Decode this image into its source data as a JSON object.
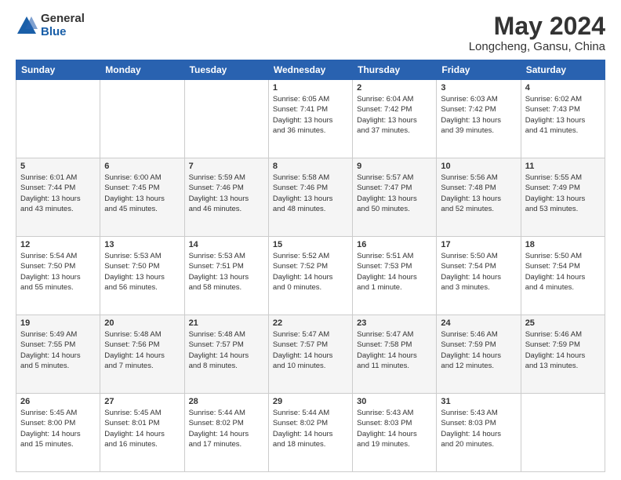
{
  "logo": {
    "general": "General",
    "blue": "Blue"
  },
  "title": "May 2024",
  "subtitle": "Longcheng, Gansu, China",
  "days_of_week": [
    "Sunday",
    "Monday",
    "Tuesday",
    "Wednesday",
    "Thursday",
    "Friday",
    "Saturday"
  ],
  "weeks": [
    [
      {
        "day": "",
        "info": ""
      },
      {
        "day": "",
        "info": ""
      },
      {
        "day": "",
        "info": ""
      },
      {
        "day": "1",
        "info": "Sunrise: 6:05 AM\nSunset: 7:41 PM\nDaylight: 13 hours\nand 36 minutes."
      },
      {
        "day": "2",
        "info": "Sunrise: 6:04 AM\nSunset: 7:42 PM\nDaylight: 13 hours\nand 37 minutes."
      },
      {
        "day": "3",
        "info": "Sunrise: 6:03 AM\nSunset: 7:42 PM\nDaylight: 13 hours\nand 39 minutes."
      },
      {
        "day": "4",
        "info": "Sunrise: 6:02 AM\nSunset: 7:43 PM\nDaylight: 13 hours\nand 41 minutes."
      }
    ],
    [
      {
        "day": "5",
        "info": "Sunrise: 6:01 AM\nSunset: 7:44 PM\nDaylight: 13 hours\nand 43 minutes."
      },
      {
        "day": "6",
        "info": "Sunrise: 6:00 AM\nSunset: 7:45 PM\nDaylight: 13 hours\nand 45 minutes."
      },
      {
        "day": "7",
        "info": "Sunrise: 5:59 AM\nSunset: 7:46 PM\nDaylight: 13 hours\nand 46 minutes."
      },
      {
        "day": "8",
        "info": "Sunrise: 5:58 AM\nSunset: 7:46 PM\nDaylight: 13 hours\nand 48 minutes."
      },
      {
        "day": "9",
        "info": "Sunrise: 5:57 AM\nSunset: 7:47 PM\nDaylight: 13 hours\nand 50 minutes."
      },
      {
        "day": "10",
        "info": "Sunrise: 5:56 AM\nSunset: 7:48 PM\nDaylight: 13 hours\nand 52 minutes."
      },
      {
        "day": "11",
        "info": "Sunrise: 5:55 AM\nSunset: 7:49 PM\nDaylight: 13 hours\nand 53 minutes."
      }
    ],
    [
      {
        "day": "12",
        "info": "Sunrise: 5:54 AM\nSunset: 7:50 PM\nDaylight: 13 hours\nand 55 minutes."
      },
      {
        "day": "13",
        "info": "Sunrise: 5:53 AM\nSunset: 7:50 PM\nDaylight: 13 hours\nand 56 minutes."
      },
      {
        "day": "14",
        "info": "Sunrise: 5:53 AM\nSunset: 7:51 PM\nDaylight: 13 hours\nand 58 minutes."
      },
      {
        "day": "15",
        "info": "Sunrise: 5:52 AM\nSunset: 7:52 PM\nDaylight: 14 hours\nand 0 minutes."
      },
      {
        "day": "16",
        "info": "Sunrise: 5:51 AM\nSunset: 7:53 PM\nDaylight: 14 hours\nand 1 minute."
      },
      {
        "day": "17",
        "info": "Sunrise: 5:50 AM\nSunset: 7:54 PM\nDaylight: 14 hours\nand 3 minutes."
      },
      {
        "day": "18",
        "info": "Sunrise: 5:50 AM\nSunset: 7:54 PM\nDaylight: 14 hours\nand 4 minutes."
      }
    ],
    [
      {
        "day": "19",
        "info": "Sunrise: 5:49 AM\nSunset: 7:55 PM\nDaylight: 14 hours\nand 5 minutes."
      },
      {
        "day": "20",
        "info": "Sunrise: 5:48 AM\nSunset: 7:56 PM\nDaylight: 14 hours\nand 7 minutes."
      },
      {
        "day": "21",
        "info": "Sunrise: 5:48 AM\nSunset: 7:57 PM\nDaylight: 14 hours\nand 8 minutes."
      },
      {
        "day": "22",
        "info": "Sunrise: 5:47 AM\nSunset: 7:57 PM\nDaylight: 14 hours\nand 10 minutes."
      },
      {
        "day": "23",
        "info": "Sunrise: 5:47 AM\nSunset: 7:58 PM\nDaylight: 14 hours\nand 11 minutes."
      },
      {
        "day": "24",
        "info": "Sunrise: 5:46 AM\nSunset: 7:59 PM\nDaylight: 14 hours\nand 12 minutes."
      },
      {
        "day": "25",
        "info": "Sunrise: 5:46 AM\nSunset: 7:59 PM\nDaylight: 14 hours\nand 13 minutes."
      }
    ],
    [
      {
        "day": "26",
        "info": "Sunrise: 5:45 AM\nSunset: 8:00 PM\nDaylight: 14 hours\nand 15 minutes."
      },
      {
        "day": "27",
        "info": "Sunrise: 5:45 AM\nSunset: 8:01 PM\nDaylight: 14 hours\nand 16 minutes."
      },
      {
        "day": "28",
        "info": "Sunrise: 5:44 AM\nSunset: 8:02 PM\nDaylight: 14 hours\nand 17 minutes."
      },
      {
        "day": "29",
        "info": "Sunrise: 5:44 AM\nSunset: 8:02 PM\nDaylight: 14 hours\nand 18 minutes."
      },
      {
        "day": "30",
        "info": "Sunrise: 5:43 AM\nSunset: 8:03 PM\nDaylight: 14 hours\nand 19 minutes."
      },
      {
        "day": "31",
        "info": "Sunrise: 5:43 AM\nSunset: 8:03 PM\nDaylight: 14 hours\nand 20 minutes."
      },
      {
        "day": "",
        "info": ""
      }
    ]
  ]
}
